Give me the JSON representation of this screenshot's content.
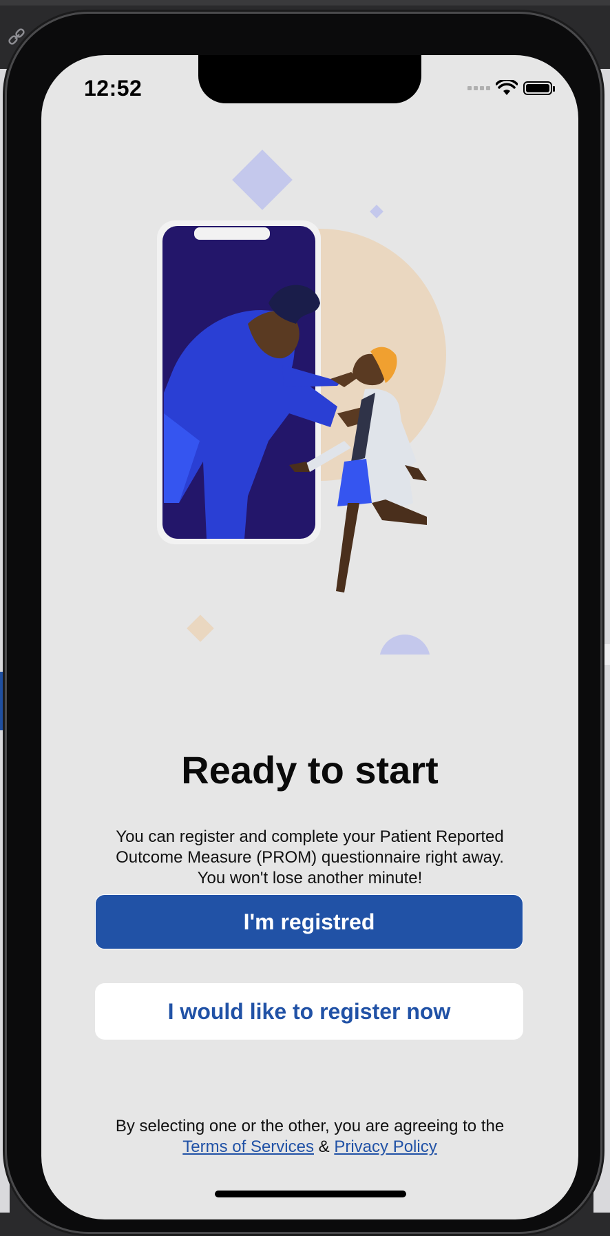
{
  "status_bar": {
    "time": "12:52"
  },
  "onboarding": {
    "title": "Ready to start",
    "description": "You can register and complete your Patient Reported\nOutcome Measure (PROM) questionnaire right away.\nYou won't lose another minute!",
    "primary_button": "I'm registred",
    "secondary_button": "I would like to register now",
    "consent_text": "By selecting one or the other, you are agreeing to the",
    "terms_link": "Terms of Services",
    "ampersand": "&",
    "privacy_link": "Privacy Policy"
  },
  "colors": {
    "brand_blue": "#2152a6",
    "screen_background": "#e6e6e6",
    "illustration_navy": "#23166a",
    "illustration_blue": "#2a3fd4",
    "illustration_peach": "#ead7c0",
    "illustration_orange": "#f0a030"
  },
  "icons": [
    "link-icon",
    "wifi-icon",
    "battery-icon",
    "cellular-signal-icon"
  ]
}
